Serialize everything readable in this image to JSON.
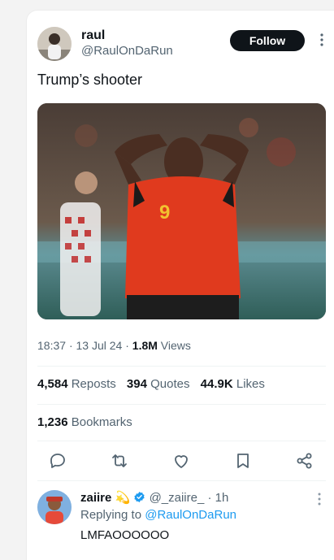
{
  "tweet": {
    "author_name": "raul",
    "author_handle": "@RaulOnDaRun",
    "follow_label": "Follow",
    "text": "Trump’s shooter",
    "media_alt_icon": "photo-soccer-player",
    "jersey_number": "9",
    "time": "18:37",
    "date": "13 Jul 24",
    "views_count": "1.8M",
    "views_label": "Views",
    "sep": "·"
  },
  "stats": {
    "reposts_count": "4,584",
    "reposts_label": "Reposts",
    "quotes_count": "394",
    "quotes_label": "Quotes",
    "likes_count": "44.9K",
    "likes_label": "Likes",
    "bookmarks_count": "1,236",
    "bookmarks_label": "Bookmarks"
  },
  "actions": [
    "reply-icon",
    "repost-icon",
    "like-icon",
    "bookmark-icon",
    "share-icon"
  ],
  "reply": {
    "name": "zaiire",
    "emoji": "💫",
    "handle": "@_zaiire_",
    "sep": "·",
    "time": "1h",
    "replying_prefix": "Replying to",
    "replying_to": "@RaulOnDaRun",
    "text": "LMFAOOOOOO"
  },
  "colors": {
    "accent": "#1d9bf0",
    "text": "#0f1419",
    "muted": "#536471",
    "jersey": "#e03a1e"
  }
}
